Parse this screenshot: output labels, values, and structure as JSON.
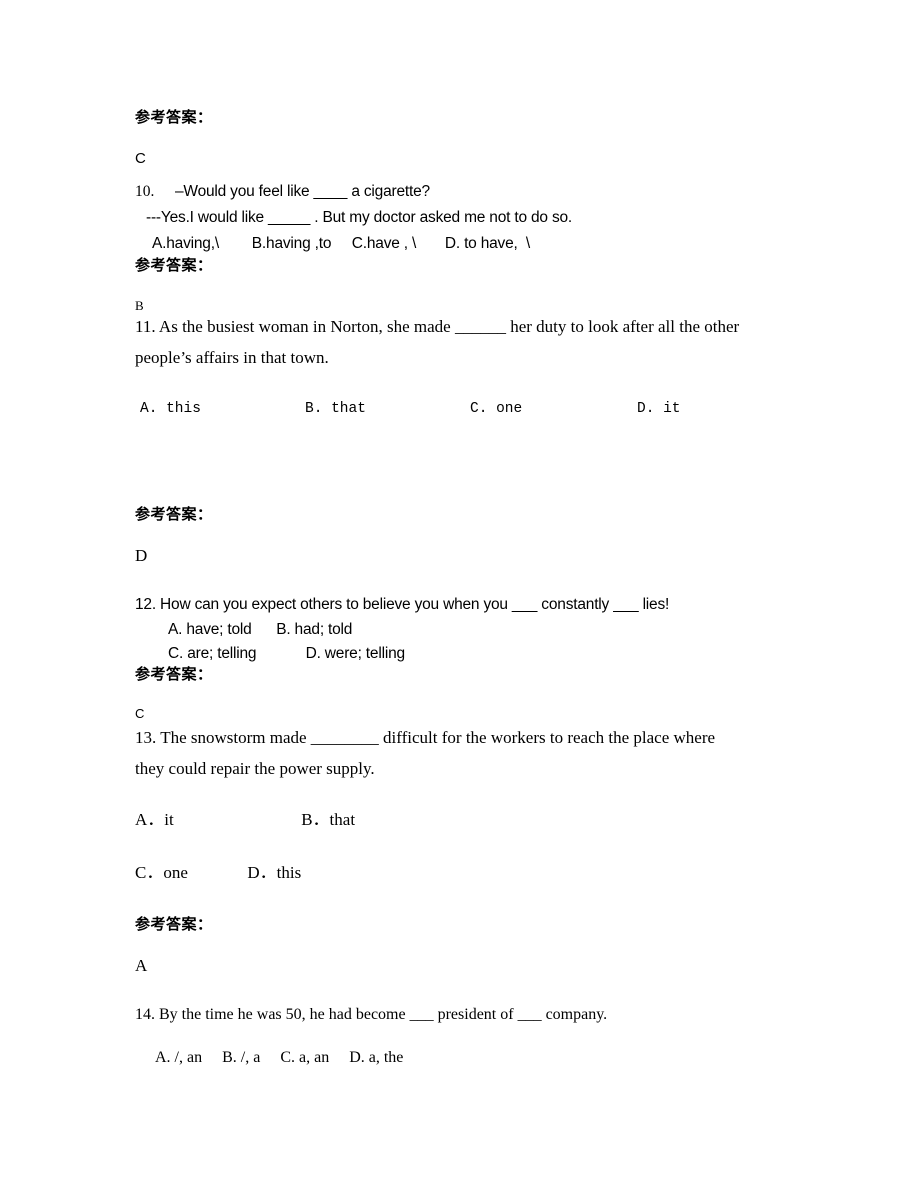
{
  "document": {
    "type": "english-exam-answer-sheet",
    "background_color": "#ffffff",
    "text_color": "#000000",
    "answer_heading": "参考答案："
  },
  "blocks": {
    "answer_09": {
      "heading": "参考答案：",
      "letter": "C"
    },
    "q10": {
      "number": "10.",
      "line1": "–Would you feel like ____ a cigarette?",
      "line2": "---Yes.I would like _____ . But my doctor asked me not to do so.",
      "options_line": "A.having,\\        B.having ,to     C.have , \\       D. to have,  \\",
      "answer_heading": "参考答案：",
      "answer_letter": "B"
    },
    "q11": {
      "line1": "11. As the busiest woman in Norton, she made ______ her duty to look after all the other",
      "line2": "people’s affairs in that town.",
      "options": [
        {
          "label": "A. this"
        },
        {
          "label": "B. that"
        },
        {
          "label": "C. one"
        },
        {
          "label": "D. it"
        }
      ],
      "answer_heading": "参考答案：",
      "answer_letter": "D"
    },
    "q12": {
      "line1": "12. How can you expect others to believe you when you ___ constantly ___ lies!",
      "options_line1": "A. have; told      B. had; told",
      "options_line2": "C. are; telling            D. were; telling",
      "answer_heading": "参考答案：",
      "answer_letter": "C"
    },
    "q13": {
      "line1": "13. The snowstorm made ________ difficult for the workers to reach the place where",
      "line2": "they could repair the power supply.",
      "options_row1": "A．it                              B．that",
      "options_row2": "C．one              D．this",
      "answer_heading": "参考答案：",
      "answer_letter": "A"
    },
    "q14": {
      "line1": "14. By the time he was 50, he had become ___ president of ___ company.",
      "options_line": "A. /, an     B. /, a     C. a, an     D. a, the"
    }
  }
}
